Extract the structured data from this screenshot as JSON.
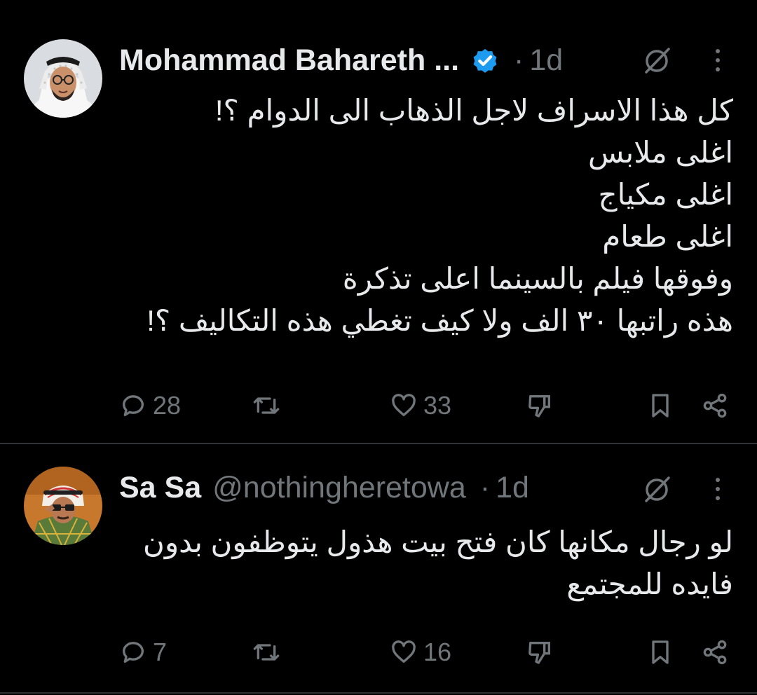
{
  "colors": {
    "background": "#000000",
    "text_primary": "#e7e9ea",
    "text_secondary": "#71767b",
    "verified_blue": "#1d9bf0",
    "divider": "#2f3336"
  },
  "tweets": [
    {
      "display_name": "Mohammad Bahareth ...",
      "handle": "",
      "verified": true,
      "separator": "·",
      "time": "1d",
      "body_lines": [
        "كل هذا الاسراف لاجل الذهاب الى الدوام ؟!",
        "اغلى ملابس",
        "اغلى مكياج",
        "اغلى طعام",
        "وفوقها فيلم بالسينما اعلى تذكرة",
        "هذه راتبها ٣٠ الف ولا كيف تغطي هذه التكاليف ؟!"
      ],
      "replies": "28",
      "retweets": "",
      "likes": "33",
      "avatar_icon": "avatar-man-ghutra-glasses"
    },
    {
      "display_name": "Sa Sa",
      "handle": "@nothingheretowa",
      "verified": false,
      "separator": "·",
      "time": "1d",
      "body_lines": [
        "لو رجال مكانها كان فتح بيت هذول يتوظفون بدون",
        "فايده للمجتمع"
      ],
      "replies": "7",
      "retweets": "",
      "likes": "16",
      "avatar_icon": "avatar-man-plaid-jacket"
    }
  ],
  "icons": {
    "grok": "slashed-circle-icon",
    "more": "more-vertical-icon",
    "reply": "reply-icon",
    "retweet": "retweet-icon",
    "like": "heart-icon",
    "downvote": "downvote-icon",
    "bookmark": "bookmark-icon",
    "share": "share-icon"
  }
}
